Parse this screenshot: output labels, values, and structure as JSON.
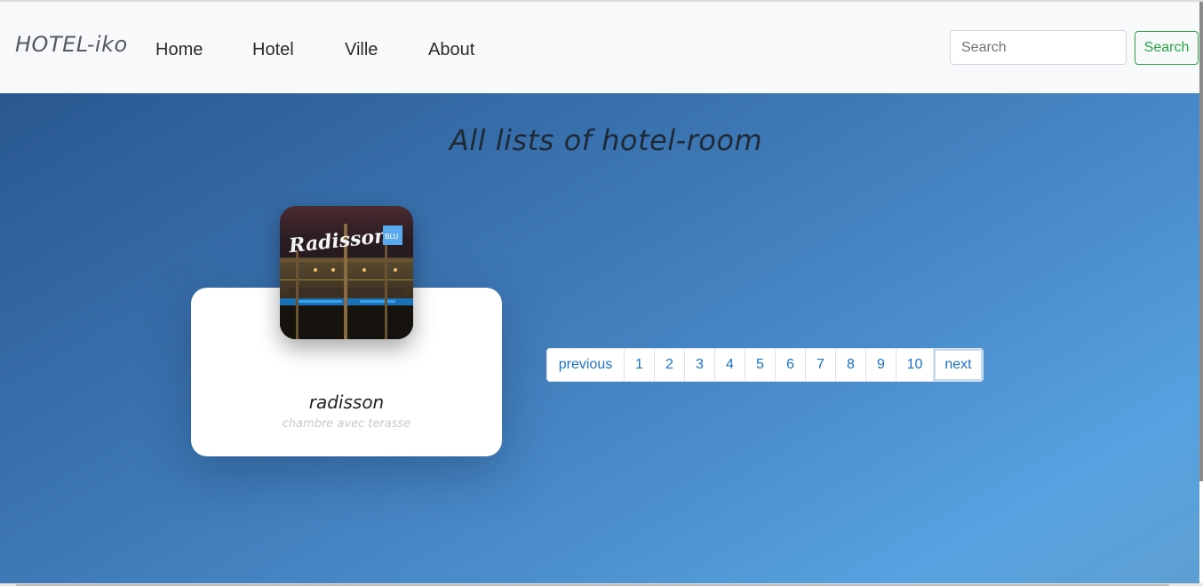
{
  "navbar": {
    "brand": "HOTEL-iko",
    "links": [
      "Home",
      "Hotel",
      "Ville",
      "About"
    ],
    "search_placeholder": "Search",
    "search_button": "Search"
  },
  "hero": {
    "title": "All lists of hotel-room"
  },
  "card": {
    "name": "radisson",
    "description": "chambre avec terasse",
    "image_sign": "Radisson",
    "image_badge": "BLU"
  },
  "pagination": {
    "previous": "previous",
    "pages": [
      "1",
      "2",
      "3",
      "4",
      "5",
      "6",
      "7",
      "8",
      "9",
      "10"
    ],
    "next": "next"
  },
  "colors": {
    "accent_green": "#28a745",
    "link_blue": "#1a73c8",
    "hero_start": "#2a5890",
    "hero_end": "#56a2e0"
  }
}
